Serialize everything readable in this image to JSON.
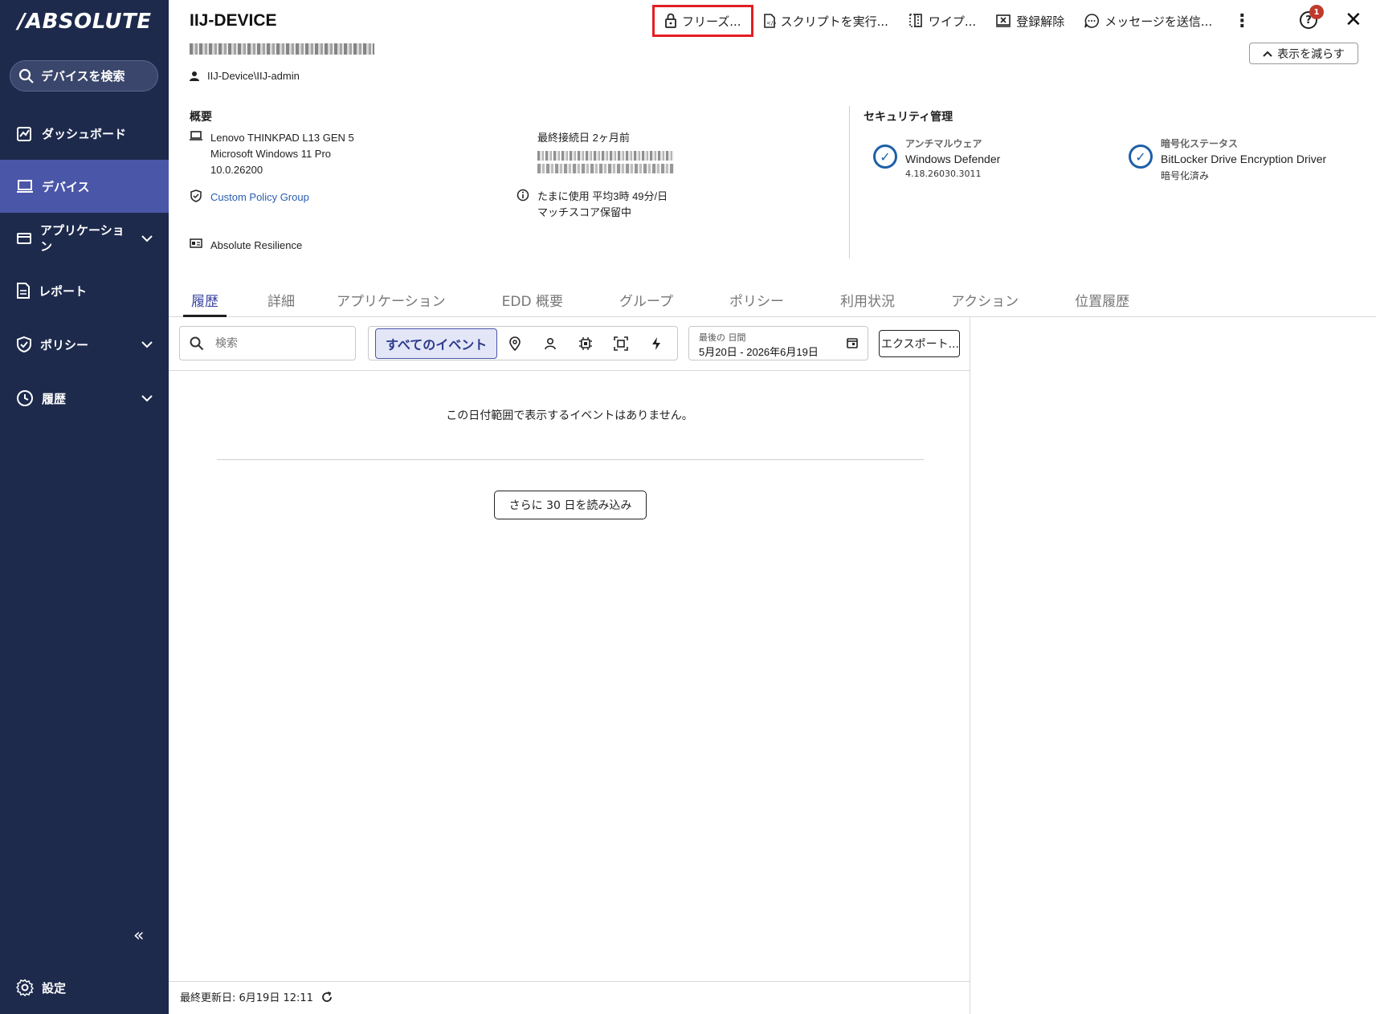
{
  "sidebar": {
    "logo": "/ABSOLUTE",
    "search_label": "デバイスを検索",
    "items": [
      {
        "label": "ダッシュボード"
      },
      {
        "label": "デバイス"
      },
      {
        "label": "アプリケーション"
      },
      {
        "label": "レポート"
      },
      {
        "label": "ポリシー"
      },
      {
        "label": "履歴"
      }
    ],
    "collapse_glyph": "«",
    "settings_label": "設定"
  },
  "header": {
    "device_name": "IIJ-DEVICE",
    "user": "IIJ-Device\\IIJ-admin",
    "show_less": "表示を減らす",
    "help_badge": "1",
    "toolbar": {
      "freeze": "フリーズ...",
      "run_script": "スクリプトを実行...",
      "wipe": "ワイプ...",
      "unregister": "登録解除",
      "send_message": "メッセージを送信..."
    }
  },
  "overview": {
    "heading": "概要",
    "model": "Lenovo THINKPAD L13 GEN 5",
    "os": "Microsoft Windows 11 Pro",
    "os_version": "10.0.26200",
    "policy_group": "Custom Policy Group",
    "product": "Absolute Resilience",
    "last_connected": "最終接続日 2ヶ月前",
    "usage": "たまに使用 平均3時 49分/日",
    "match_score": "マッチスコア保留中"
  },
  "security": {
    "heading": "セキュリティ管理",
    "antimalware_label": "アンチマルウェア",
    "antimalware_value": "Windows Defender",
    "antimalware_version": "4.18.26030.3011",
    "encryption_label": "暗号化ステータス",
    "encryption_value": "BitLocker Drive Encryption Driver",
    "encryption_status": "暗号化済み"
  },
  "tabs": [
    {
      "label": "履歴",
      "active": true
    },
    {
      "label": "詳細"
    },
    {
      "label": "アプリケーション"
    },
    {
      "label": "EDD 概要"
    },
    {
      "label": "グループ"
    },
    {
      "label": "ポリシー"
    },
    {
      "label": "利用状況"
    },
    {
      "label": "アクション"
    },
    {
      "label": "位置履歴"
    }
  ],
  "filters": {
    "search_placeholder": "検索",
    "all_events": "すべてのイベント",
    "date_label": "最後の 日間",
    "date_value": "5月20日 - 2026年6月19日",
    "export": "エクスポート..."
  },
  "history": {
    "empty_message": "この日付範囲で表示するイベントはありません。",
    "load_more": "さらに 30 日を読み込み",
    "last_updated": "最終更新日: 6月19日 12:11"
  },
  "colors": {
    "sidebar_bg": "#1d2a4c",
    "sidebar_active": "#4a56a8",
    "accent": "#3a46a0",
    "highlight_border": "#e31e24",
    "check_blue": "#1d5fa8"
  }
}
